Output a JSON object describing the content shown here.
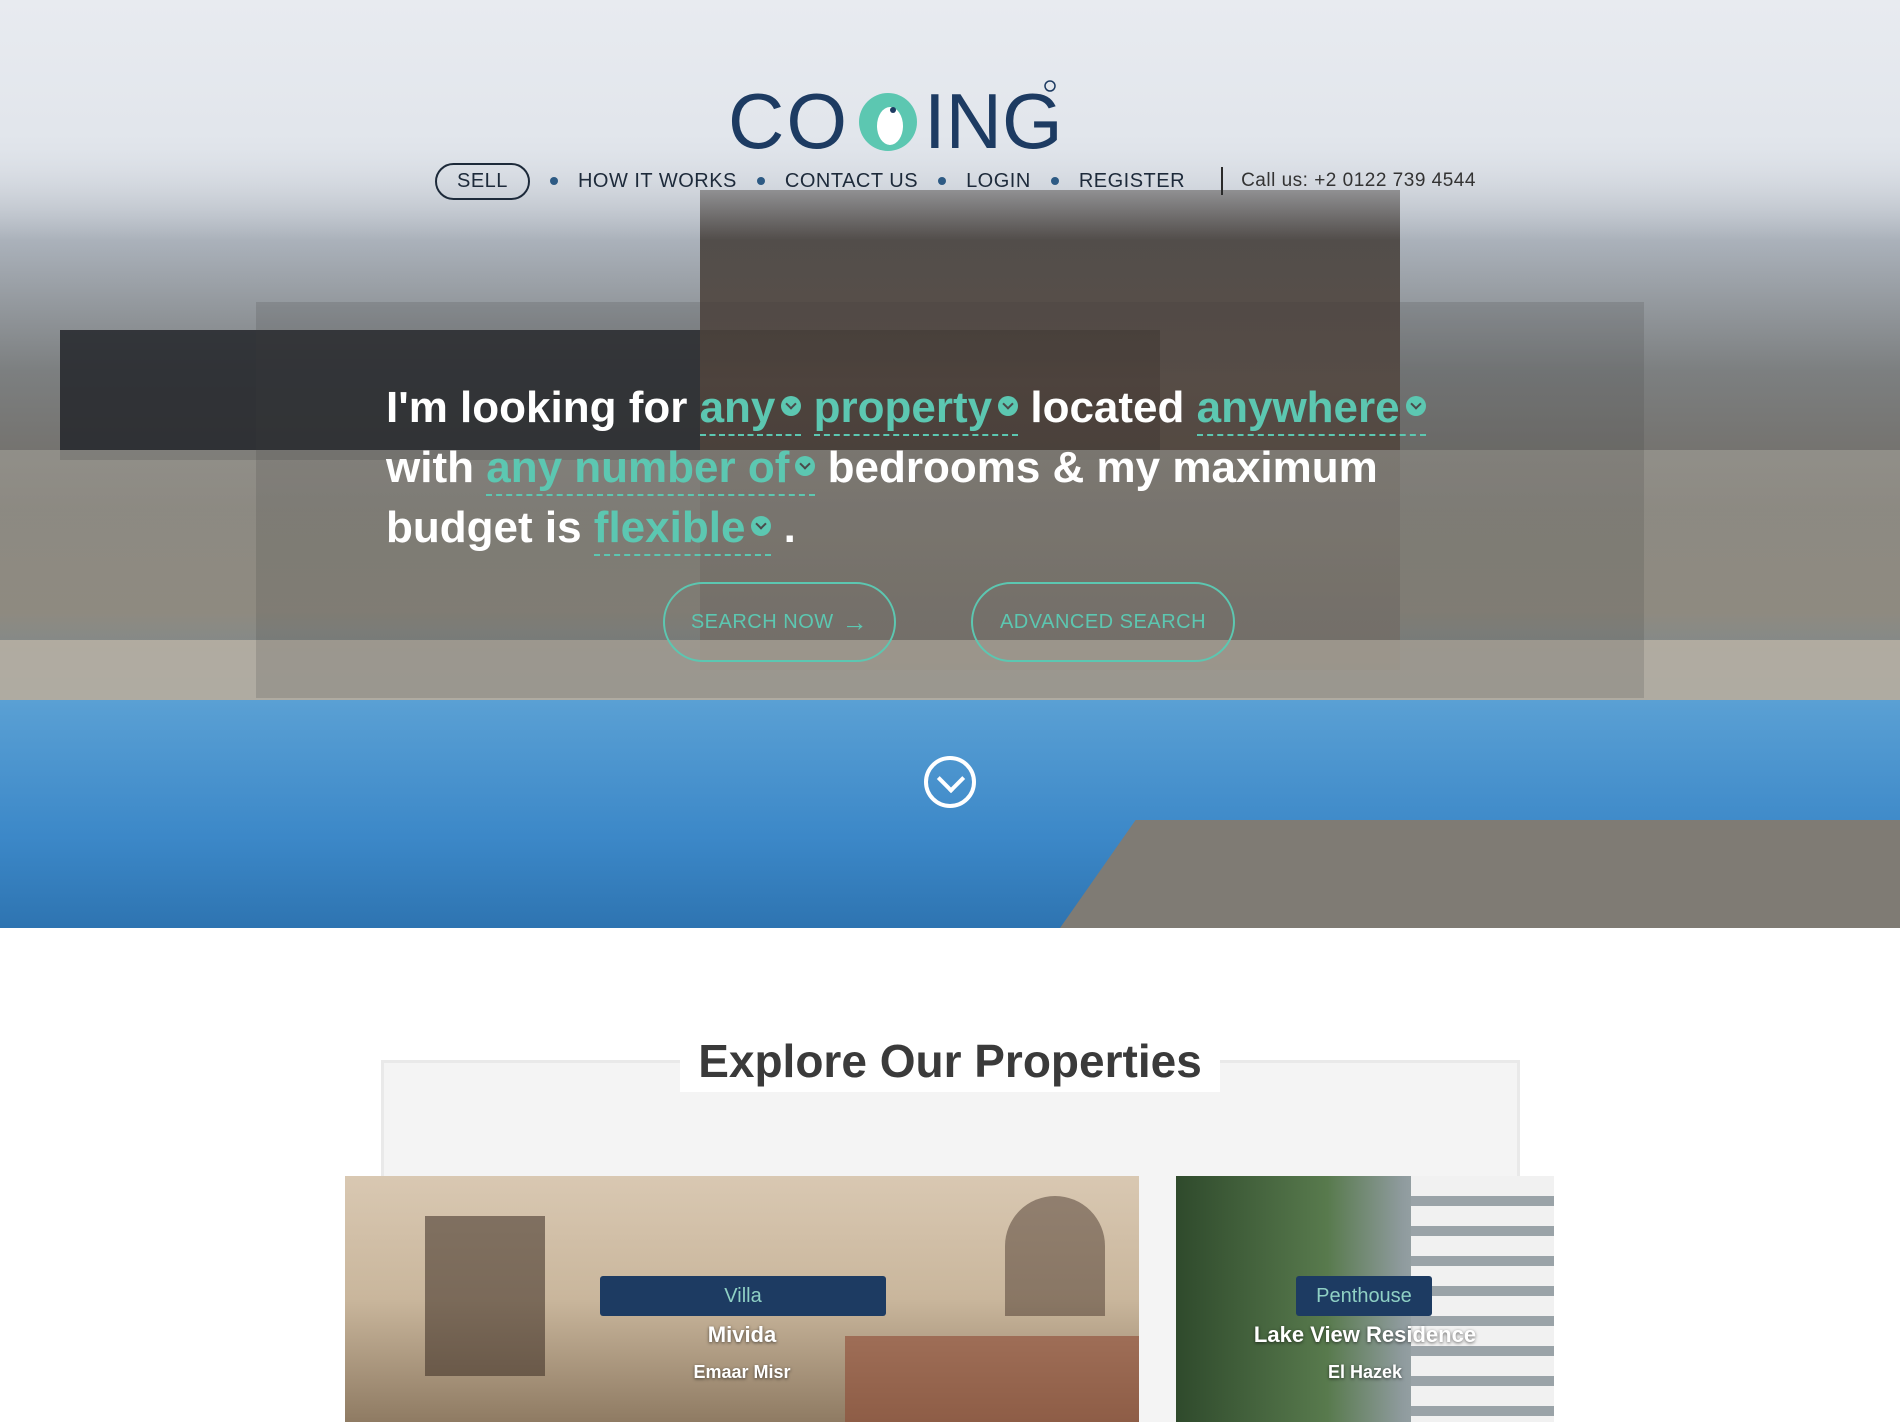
{
  "logo": {
    "text": "COOING",
    "registered": "®"
  },
  "nav": {
    "sell": "SELL",
    "how_it_works": "HOW IT WORKS",
    "contact_us": "CONTACT US",
    "login": "LOGIN",
    "register": "REGISTER",
    "phone": "Call us: +2 0122 739 4544"
  },
  "search": {
    "intro": "I'm looking for",
    "property_scope": "any",
    "property_type": "property",
    "located_label": "located",
    "location": "anywhere",
    "with_label": "with",
    "bedrooms_value": "any number of",
    "bedrooms_label": "bedrooms & my maximum",
    "budget_label": "budget is",
    "budget_value": "flexible",
    "period": ".",
    "search_button": "SEARCH NOW",
    "search_arrow": "→",
    "advanced_button": "ADVANCED SEARCH"
  },
  "explore": {
    "title": "Explore Our Properties"
  },
  "properties": [
    {
      "type": "Villa",
      "name": "Mivida",
      "developer": "Emaar Misr"
    },
    {
      "type": "Penthouse",
      "name": "Lake View Residence",
      "developer": "El Hazek"
    }
  ],
  "colors": {
    "accent": "#5cc7b1",
    "navy": "#1d3b62",
    "nav_text": "#1d2a3a"
  },
  "icons": {
    "dropdown": "chevron-down-icon",
    "scroll": "scroll-down-icon",
    "arrow": "arrow-right-icon"
  }
}
